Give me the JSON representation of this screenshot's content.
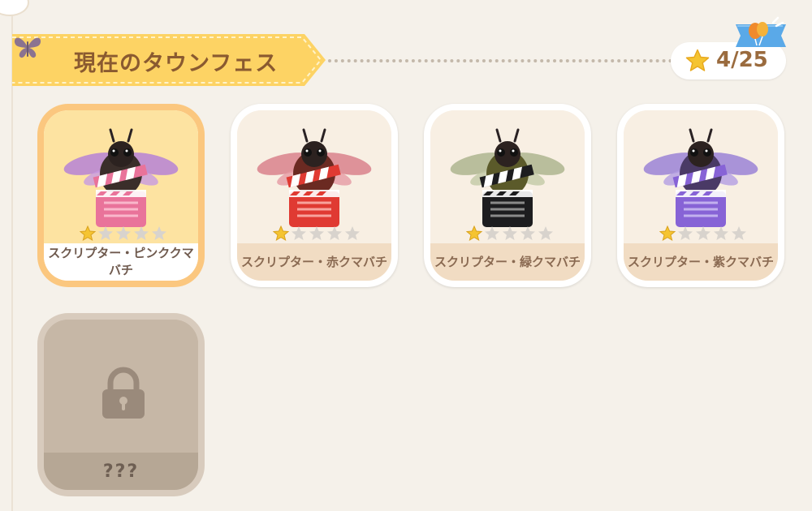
{
  "header": {
    "title": "現在のタウンフェス"
  },
  "progress": {
    "text": "4/25"
  },
  "icons": {
    "butterfly": "butterfly-icon",
    "star": "star-icon",
    "balloon": "balloon-badge-icon",
    "lock": "lock-icon",
    "bee": "bee-icon",
    "clapperboard": "clapperboard-icon"
  },
  "colors": {
    "ribbon": "#fdd364",
    "selected_border": "#fbc77f",
    "title_text": "#8a5a30",
    "star_gold": "#f5c431"
  },
  "cards": [
    {
      "label": "スクリプター・ピンククマバチ",
      "rating": 1,
      "max_rating": 5,
      "color": "#e9739a",
      "selected": true
    },
    {
      "label": "スクリプター・赤クマバチ",
      "rating": 1,
      "max_rating": 5,
      "color": "#e03a32",
      "selected": false
    },
    {
      "label": "スクリプター・緑クマバチ",
      "rating": 1,
      "max_rating": 5,
      "color": "#1d1d1f",
      "selected": false
    },
    {
      "label": "スクリプター・紫クマバチ",
      "rating": 1,
      "max_rating": 5,
      "color": "#8763d6",
      "selected": false
    },
    {
      "label": "???",
      "locked": true
    }
  ]
}
